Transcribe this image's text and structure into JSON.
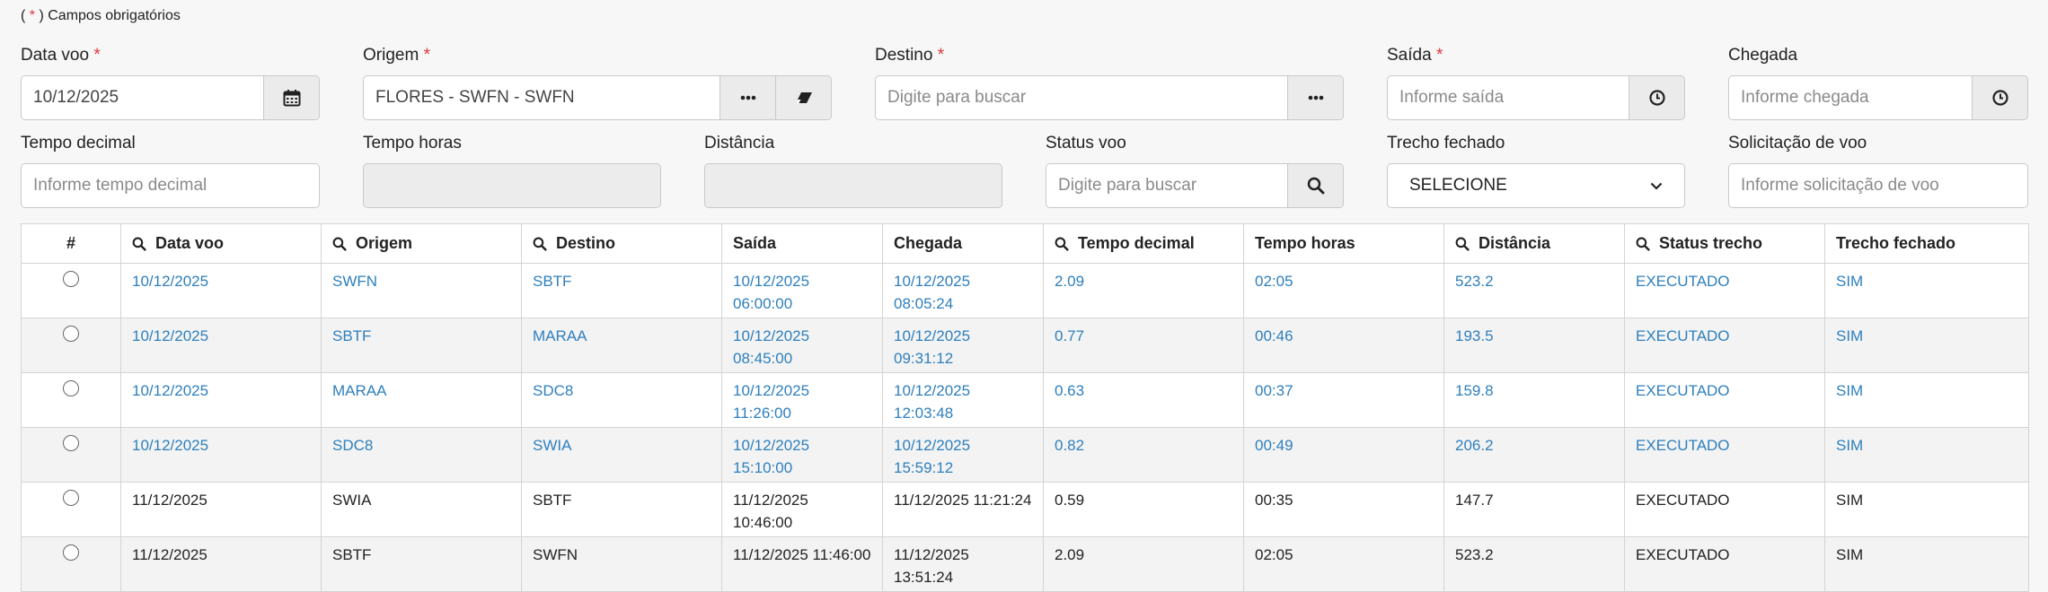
{
  "required_note": {
    "open": "( ",
    "star": "*",
    "close": " ) Campos obrigatórios"
  },
  "form": {
    "data_voo": {
      "label": "Data voo",
      "value": "10/12/2025",
      "required": true
    },
    "origem": {
      "label": "Origem",
      "value": "FLORES - SWFN - SWFN",
      "required": true
    },
    "destino": {
      "label": "Destino",
      "placeholder": "Digite para buscar",
      "required": true
    },
    "saida": {
      "label": "Saída",
      "placeholder": "Informe saída",
      "required": true
    },
    "chegada": {
      "label": "Chegada",
      "placeholder": "Informe chegada"
    },
    "tempo_decimal": {
      "label": "Tempo decimal",
      "placeholder": "Informe tempo decimal"
    },
    "tempo_horas": {
      "label": "Tempo horas"
    },
    "distancia": {
      "label": "Distância"
    },
    "status_voo": {
      "label": "Status voo",
      "placeholder": "Digite para buscar"
    },
    "trecho_fechado": {
      "label": "Trecho fechado",
      "selected": "SELECIONE"
    },
    "solicitacao_voo": {
      "label": "Solicitação de voo",
      "placeholder": "Informe solicitação de voo"
    }
  },
  "icons": {
    "calendar": "calendar-icon",
    "ellipsis": "ellipsis-icon",
    "eraser": "eraser-icon",
    "clock": "clock-icon",
    "search": "search-icon",
    "chevron": "chevron-down-icon"
  },
  "colors": {
    "required": "#e0353b",
    "link": "#2e7fbd"
  },
  "table": {
    "columns": [
      "#",
      "Data voo",
      "Origem",
      "Destino",
      "Saída",
      "Chegada",
      "Tempo decimal",
      "Tempo horas",
      "Distância",
      "Status trecho",
      "Trecho fechado"
    ],
    "rows": [
      [
        "10/12/2025",
        "SWFN",
        "SBTF",
        "10/12/2025 06:00:00",
        "10/12/2025 08:05:24",
        "2.09",
        "02:05",
        "523.2",
        "EXECUTADO",
        "SIM"
      ],
      [
        "10/12/2025",
        "SBTF",
        "MARAA",
        "10/12/2025 08:45:00",
        "10/12/2025 09:31:12",
        "0.77",
        "00:46",
        "193.5",
        "EXECUTADO",
        "SIM"
      ],
      [
        "10/12/2025",
        "MARAA",
        "SDC8",
        "10/12/2025 11:26:00",
        "10/12/2025 12:03:48",
        "0.63",
        "00:37",
        "159.8",
        "EXECUTADO",
        "SIM"
      ],
      [
        "10/12/2025",
        "SDC8",
        "SWIA",
        "10/12/2025 15:10:00",
        "10/12/2025 15:59:12",
        "0.82",
        "00:49",
        "206.2",
        "EXECUTADO",
        "SIM"
      ],
      [
        "11/12/2025",
        "SWIA",
        "SBTF",
        "11/12/2025 10:46:00",
        "11/12/2025 11:21:24",
        "0.59",
        "00:35",
        "147.7",
        "EXECUTADO",
        "SIM"
      ],
      [
        "11/12/2025",
        "SBTF",
        "SWFN",
        "11/12/2025 11:46:00",
        "11/12/2025 13:51:24",
        "2.09",
        "02:05",
        "523.2",
        "EXECUTADO",
        "SIM"
      ]
    ]
  }
}
